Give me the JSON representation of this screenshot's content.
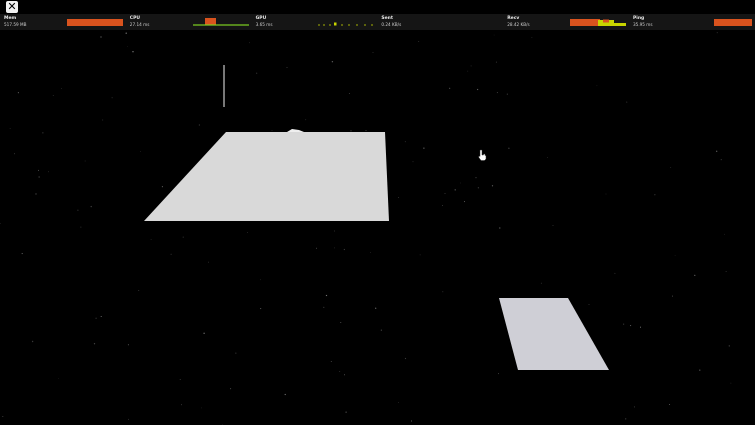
{
  "window": {
    "close_icon": "close-icon",
    "close_glyph": "✕"
  },
  "stats": [
    {
      "label": "Mem",
      "value": "517.59 MB",
      "graph_color": "#d9531e"
    },
    {
      "label": "CPU",
      "value": "27.14 ms",
      "graph_color": "#d9531e"
    },
    {
      "label": "GPU",
      "value": "3.65 ms",
      "graph_color": "#c8d400"
    },
    {
      "label": "Sent",
      "value": "0.24 KB/s",
      "graph_color": "#c8d400"
    },
    {
      "label": "Recv",
      "value": "28.42 KB/s",
      "graph_color": "#d9531e"
    },
    {
      "label": "Ping",
      "value": "35.95 ms",
      "graph_color": "#d9531e"
    }
  ],
  "scene": {
    "background": "#000000",
    "floor_color": "#d9d9d9",
    "floor_color_2": "#cfcfd6",
    "cursor_icon": "hand-cursor-icon"
  }
}
